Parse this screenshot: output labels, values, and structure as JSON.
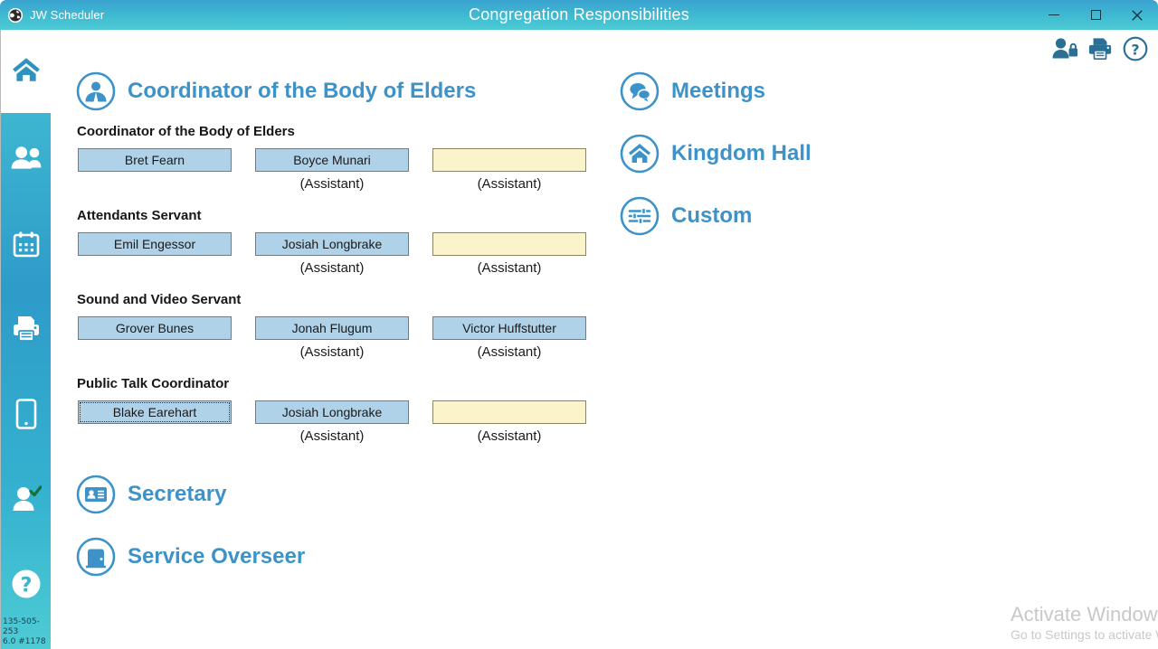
{
  "window": {
    "app_title": "JW Scheduler",
    "app_icon": "globe-icon",
    "title": "Congregation Responsibilities",
    "controls": {
      "minimize": "minimize-button",
      "maximize": "maximize-button",
      "close": "close-button"
    },
    "accent": "#3d93c9",
    "titlebar_gradient_start": "#3aa2d0",
    "titlebar_gradient_end": "#4ecbd4"
  },
  "sidebar": {
    "items": [
      {
        "name": "home",
        "icon": "home-icon",
        "selected": true
      },
      {
        "name": "publishers",
        "icon": "people-icon",
        "selected": false
      },
      {
        "name": "schedule",
        "icon": "calendar-icon",
        "selected": false
      },
      {
        "name": "print",
        "icon": "printer-icon",
        "selected": false
      },
      {
        "name": "mobile",
        "icon": "phone-icon",
        "selected": false
      },
      {
        "name": "attendance",
        "icon": "person-check-icon",
        "selected": false
      },
      {
        "name": "help",
        "icon": "question-circle-icon",
        "selected": false
      }
    ],
    "version_line1": "135-505-253",
    "version_line2": "6.0 #1178"
  },
  "toolbar": {
    "items": [
      {
        "name": "user-lock",
        "icon": "person-lock-icon"
      },
      {
        "name": "print",
        "icon": "printer-icon"
      },
      {
        "name": "help",
        "icon": "question-circle-icon"
      }
    ]
  },
  "main": {
    "sections": [
      {
        "id": "coordinator",
        "label": "Coordinator of the Body of Elders",
        "icon": "person-circle-icon",
        "expanded": true
      },
      {
        "id": "secretary",
        "label": "Secretary",
        "icon": "id-card-circle-icon",
        "expanded": false
      },
      {
        "id": "service-overseer",
        "label": "Service Overseer",
        "icon": "door-circle-icon",
        "expanded": false
      },
      {
        "id": "meetings",
        "label": "Meetings",
        "icon": "chat-circle-icon",
        "expanded": false
      },
      {
        "id": "kingdom-hall",
        "label": "Kingdom Hall",
        "icon": "home-circle-icon",
        "expanded": false
      },
      {
        "id": "custom",
        "label": "Custom",
        "icon": "sliders-circle-icon",
        "expanded": false
      }
    ],
    "assistant_label": "(Assistant)",
    "groups": [
      {
        "title": "Coordinator of the Body of Elders",
        "primary": {
          "value": "Bret Fearn",
          "state": "filled",
          "focused": false
        },
        "assistant1": {
          "value": "Boyce Munari",
          "state": "filled",
          "focused": false
        },
        "assistant2": {
          "value": "",
          "state": "empty",
          "focused": false
        }
      },
      {
        "title": "Attendants Servant",
        "primary": {
          "value": "Emil Engessor",
          "state": "filled",
          "focused": false
        },
        "assistant1": {
          "value": "Josiah Longbrake",
          "state": "filled",
          "focused": false
        },
        "assistant2": {
          "value": "",
          "state": "empty",
          "focused": false
        }
      },
      {
        "title": "Sound and Video Servant",
        "primary": {
          "value": "Grover Bunes",
          "state": "filled",
          "focused": false
        },
        "assistant1": {
          "value": "Jonah Flugum",
          "state": "filled",
          "focused": false
        },
        "assistant2": {
          "value": "Victor Huffstutter",
          "state": "filled",
          "focused": false
        }
      },
      {
        "title": "Public Talk Coordinator",
        "primary": {
          "value": "Blake Earehart",
          "state": "filled",
          "focused": true
        },
        "assistant1": {
          "value": "Josiah Longbrake",
          "state": "filled",
          "focused": false
        },
        "assistant2": {
          "value": "",
          "state": "empty",
          "focused": false
        }
      }
    ]
  },
  "watermark": {
    "line1": "Activate Windows",
    "line2": "Go to Settings to activate Windows."
  }
}
